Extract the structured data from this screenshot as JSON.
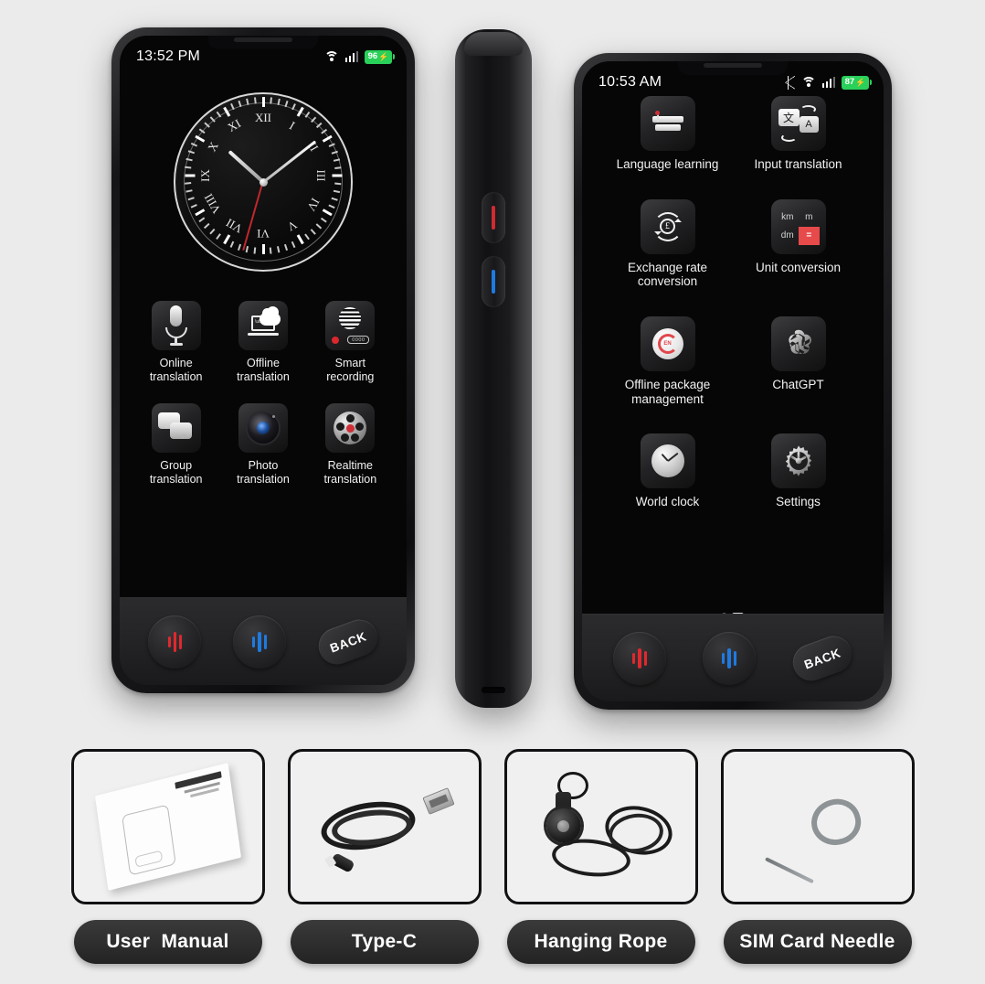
{
  "background_color": "#ebebeb",
  "phone_front": {
    "status_bar": {
      "time": "13:52 PM",
      "battery_percent": "96",
      "battery_bolt": "⚡",
      "icons": [
        "wifi-icon",
        "signal-icon",
        "battery-icon"
      ]
    },
    "clock_widget": {
      "numerals": [
        "XII",
        "I",
        "II",
        "III",
        "IV",
        "V",
        "VI",
        "VII",
        "VIII",
        "IX",
        "X",
        "XI"
      ]
    },
    "apps": [
      {
        "label": "Online\ntranslation",
        "icon": "microphone-icon"
      },
      {
        "label": "Offline\ntranslation",
        "icon": "laptop-cloud-icon"
      },
      {
        "label": "Smart\nrecording",
        "icon": "recorder-icon",
        "display_text": "0000"
      },
      {
        "label": "Group\ntranslation",
        "icon": "chat-bubbles-icon"
      },
      {
        "label": "Photo\ntranslation",
        "icon": "camera-icon"
      },
      {
        "label": "Realtime\ntranslation",
        "icon": "film-reel-icon"
      }
    ],
    "nav": {
      "left_button": "red-waveform-button",
      "middle_button": "blue-waveform-button",
      "back_label": "BACK"
    }
  },
  "phone_side": {
    "buttons": [
      "red-translate-button",
      "blue-translate-button"
    ],
    "port": "usb-c-port"
  },
  "phone_menu": {
    "status_bar": {
      "time": "10:53 AM",
      "battery_percent": "87",
      "battery_bolt": "⚡",
      "icons": [
        "bluetooth-icon",
        "wifi-icon",
        "signal-icon",
        "battery-icon"
      ]
    },
    "apps": [
      {
        "label": "Language learning",
        "icon": "books-icon"
      },
      {
        "label": "Input translation",
        "icon": "translate-icon",
        "glyph_a": "文",
        "glyph_b": "A"
      },
      {
        "label": "Exchange rate\nconversion",
        "icon": "currency-exchange-icon",
        "glyph": "£"
      },
      {
        "label": "Unit conversion",
        "icon": "unit-conversion-icon",
        "cells": [
          "km",
          "m",
          "dm",
          "="
        ],
        "accent_color": "#e64a4a"
      },
      {
        "label": "Offline package\nmanagement",
        "icon": "offline-package-icon",
        "glyph": "EN"
      },
      {
        "label": "ChatGPT",
        "icon": "chatgpt-icon"
      },
      {
        "label": "World clock",
        "icon": "world-clock-icon"
      },
      {
        "label": "Settings",
        "icon": "gear-icon"
      }
    ],
    "page_dots": {
      "total": 2,
      "active_index": 1
    },
    "nav": {
      "left_button": "red-waveform-button",
      "middle_button": "blue-waveform-button",
      "back_label": "BACK"
    }
  },
  "accessories": [
    {
      "label": "User  Manual",
      "icon": "manual-booklet"
    },
    {
      "label": "Type-C",
      "icon": "usb-c-cable"
    },
    {
      "label": "Hanging Rope",
      "icon": "lanyard"
    },
    {
      "label": "SIM Card Needle",
      "icon": "sim-ejector-pin"
    }
  ]
}
